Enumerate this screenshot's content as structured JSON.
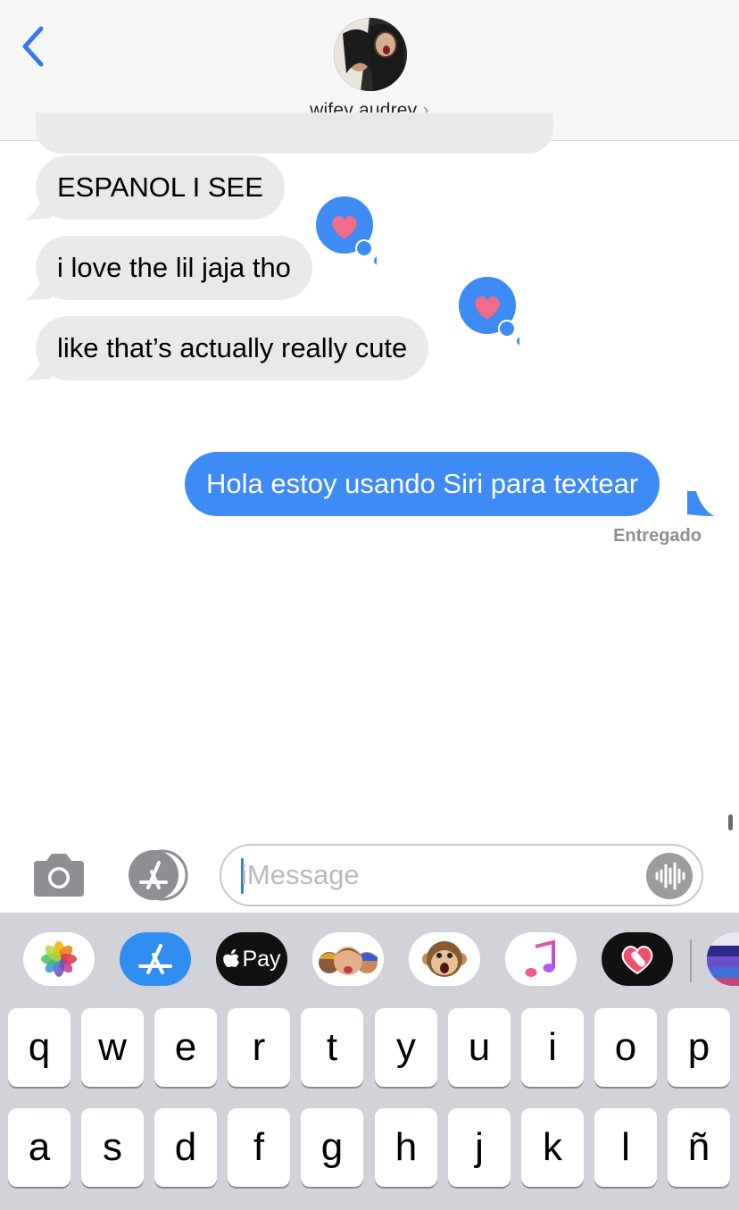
{
  "header": {
    "contact_name": "wifey audrey",
    "chevron": "›"
  },
  "messages": {
    "incoming": [
      {
        "text": "ESPANOL I SEE",
        "tapback": null
      },
      {
        "text": "i love the lil jaja tho",
        "tapback": "heart"
      },
      {
        "text": "like that’s actually really cute",
        "tapback": "heart"
      }
    ],
    "outgoing": [
      {
        "text": "Hola estoy usando Siri para textear"
      }
    ],
    "delivery_status": "Entregado"
  },
  "compose": {
    "placeholder": "iMessage",
    "value": ""
  },
  "app_strip": {
    "items": [
      "Photos",
      "App Store",
      "Pay",
      "Memoji",
      "Animoji",
      "Music",
      "Digital Touch",
      "More"
    ],
    "pay_label": "Pay"
  },
  "keyboard": {
    "row1": [
      "q",
      "w",
      "e",
      "r",
      "t",
      "y",
      "u",
      "i",
      "o",
      "p"
    ],
    "row2": [
      "a",
      "s",
      "d",
      "f",
      "g",
      "h",
      "j",
      "k",
      "l",
      "ñ"
    ]
  },
  "colors": {
    "accent": "#3478f6",
    "outgoing_bubble": "#3e8bf5",
    "incoming_bubble": "#e9e9eb",
    "tapback_heart": "#f06b8c",
    "keyboard_bg": "#d1d3d9"
  }
}
